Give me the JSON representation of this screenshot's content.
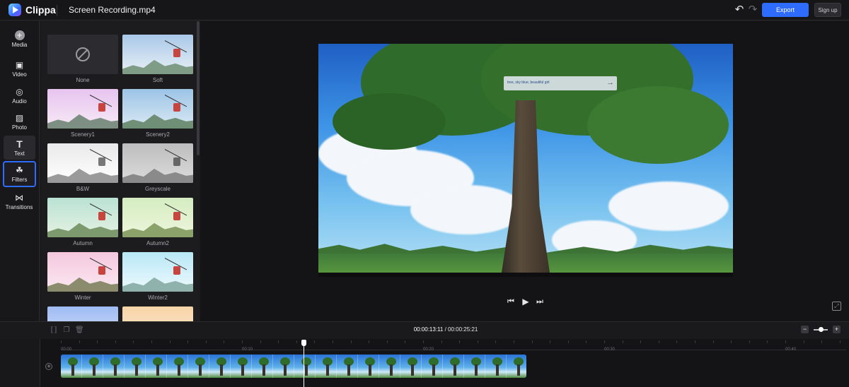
{
  "app": {
    "name": "Clippa",
    "file_title": "Screen Recording.mp4"
  },
  "toolbar": {
    "undo_icon": "undo-icon",
    "redo_icon": "redo-icon",
    "export_label": "Export",
    "signup_label": "Sign up"
  },
  "tools": [
    {
      "icon": "plus-circle-icon",
      "label": "Media"
    },
    {
      "icon": "video-icon",
      "label": "Video"
    },
    {
      "icon": "audio-icon",
      "label": "Audio"
    },
    {
      "icon": "photo-icon",
      "label": "Photo"
    },
    {
      "icon": "text-icon",
      "label": "Text"
    },
    {
      "icon": "filters-icon",
      "label": "Filters",
      "active": true
    },
    {
      "icon": "transitions-icon",
      "label": "Transitions"
    }
  ],
  "filters": [
    {
      "name": "None"
    },
    {
      "name": "Soft"
    },
    {
      "name": "Scenery1"
    },
    {
      "name": "Scenery2"
    },
    {
      "name": "B&W"
    },
    {
      "name": "Greyscale"
    },
    {
      "name": "Autumn"
    },
    {
      "name": "Autumn2"
    },
    {
      "name": "Winter"
    },
    {
      "name": "Winter2"
    }
  ],
  "preview": {
    "prompt_text": "tree, sky blue, beautiful girl"
  },
  "playback": {
    "current_time": "00:00:13:11",
    "separator": " / ",
    "total_time": "00:00:25:21"
  },
  "timeline": {
    "ruler_labels": [
      "00:00",
      "00:10",
      "00:20",
      "00:30",
      "00:40"
    ],
    "playhead_seconds": 13.4,
    "clip_duration_seconds": 25.7
  },
  "colors": {
    "accent": "#2e6bff",
    "background": "#1a1a1d"
  }
}
